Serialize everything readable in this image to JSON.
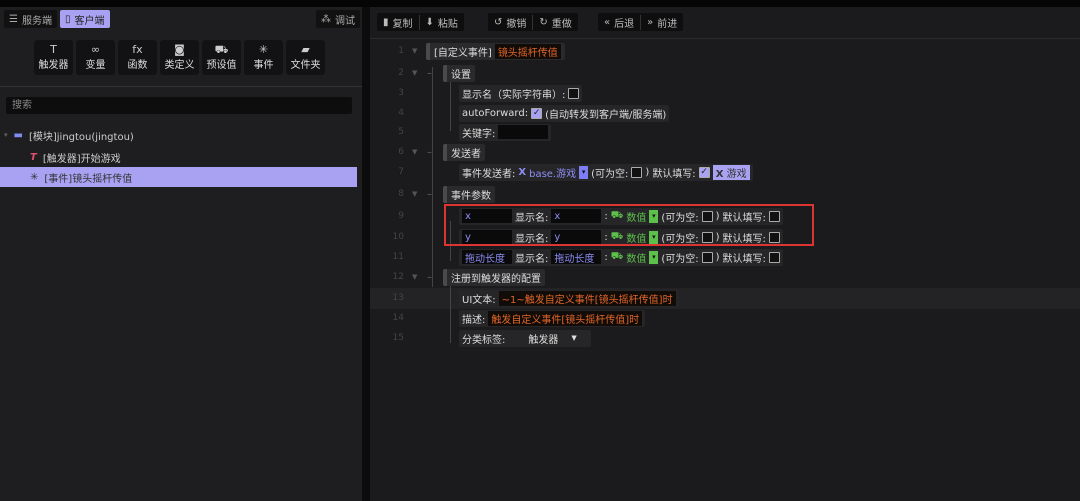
{
  "left": {
    "tabs": [
      {
        "label": "服务端",
        "icon": "server-icon"
      },
      {
        "label": "客户端",
        "icon": "phone-icon"
      }
    ],
    "debug_label": "调试",
    "tools": [
      {
        "label": "触发器",
        "icon": "T"
      },
      {
        "label": "变量",
        "icon": "∞"
      },
      {
        "label": "函数",
        "icon": "fx"
      },
      {
        "label": "类定义",
        "icon": "◙"
      },
      {
        "label": "预设值",
        "icon": "⛟"
      },
      {
        "label": "事件",
        "icon": "✳"
      },
      {
        "label": "文件夹",
        "icon": "▰"
      }
    ],
    "search_placeholder": "搜索",
    "tree": [
      {
        "label": "[模块]jingtou(jingtou)"
      },
      {
        "label": "[触发器]开始游戏"
      },
      {
        "label": "[事件]镜头摇杆传值"
      }
    ]
  },
  "toolbar": {
    "copy": "复制",
    "paste": "粘贴",
    "undo": "撤销",
    "redo": "重做",
    "back": "后退",
    "forward": "前进"
  },
  "editor": {
    "line_numbers": [
      "1",
      "2",
      "3",
      "4",
      "5",
      "6",
      "7",
      "8",
      "9",
      "10",
      "11",
      "12",
      "13",
      "14",
      "15"
    ],
    "custom_event_tag": "[自定义事件]",
    "event_name": "镜头摇杆传值",
    "settings": "设置",
    "display_name_label": "显示名（实际字符串）:",
    "autoforward_label": "autoForward:",
    "autoforward_note": "(自动转发到客户端/服务端)",
    "keyword_label": "关键字:",
    "sender": "发送者",
    "sender_label": "事件发送者:",
    "sender_value": "base.游戏",
    "nullable_label": "(可为空:",
    "nullable_close": ")",
    "default_label": "默认填写:",
    "default_value": "游戏",
    "params": "事件参数",
    "param_rows": [
      {
        "name": "x",
        "display": "x",
        "type": "数值"
      },
      {
        "name": "y",
        "display": "y",
        "type": "数值"
      },
      {
        "name": "拖动长度",
        "display": "拖动长度",
        "type": "数值"
      }
    ],
    "display_label": "显示名:",
    "register": "注册到触发器的配置",
    "ui_text_label": "UI文本:",
    "ui_text": "~1~触发自定义事件[镜头摇杆传值]时",
    "desc_label": "描述:",
    "desc": "触发自定义事件[镜头摇杆传值]时",
    "category_label": "分类标签:",
    "category": "触发器"
  }
}
